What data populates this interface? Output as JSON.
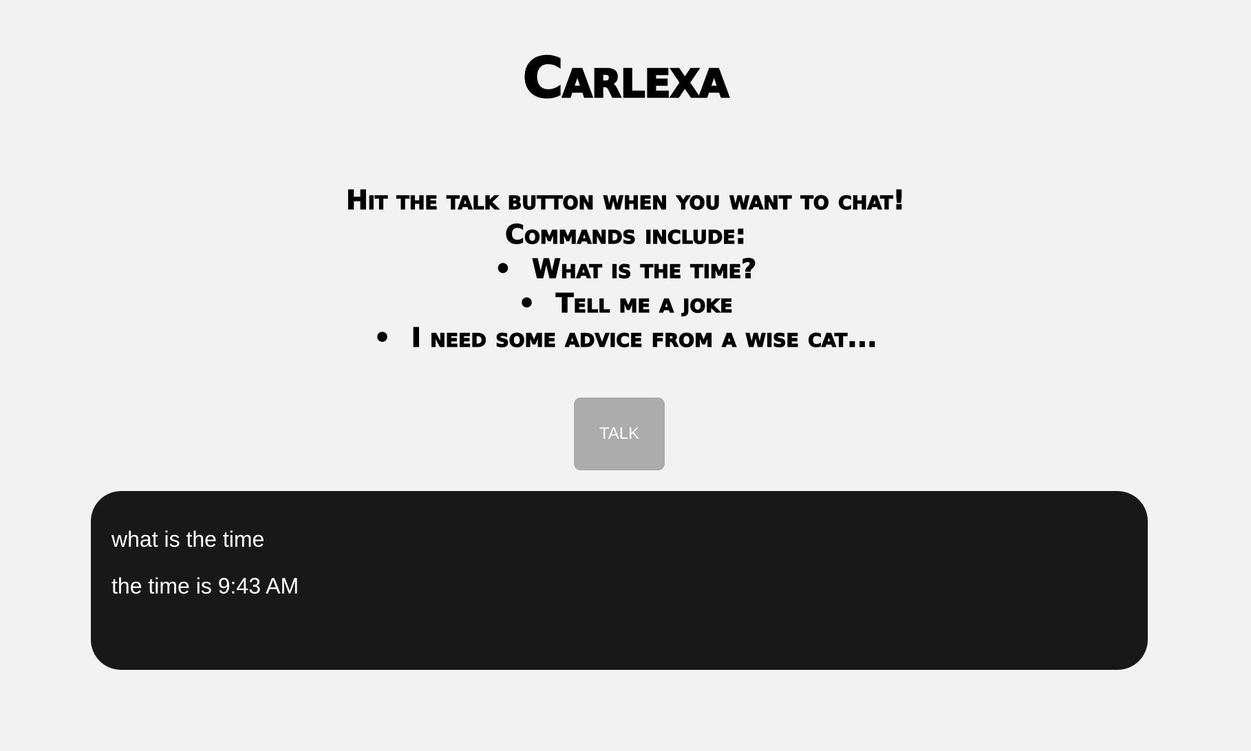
{
  "app": {
    "title": "Carlexa"
  },
  "instructions": {
    "intro": "Hit the talk button when you want to chat!",
    "commands_heading": "Commands include:",
    "bullet": "•",
    "commands": [
      "What is the time?",
      "Tell me a joke",
      "I need some advice from a wise cat..."
    ]
  },
  "talk_button": {
    "label": "TALK"
  },
  "transcript": {
    "messages": [
      "what is the time",
      "the time is 9:43 AM"
    ]
  },
  "colors": {
    "page_background": "#f2f2f2",
    "button_background": "#acacac",
    "transcript_background": "#181818",
    "text_dark": "#000000",
    "text_light": "#ffffff"
  }
}
